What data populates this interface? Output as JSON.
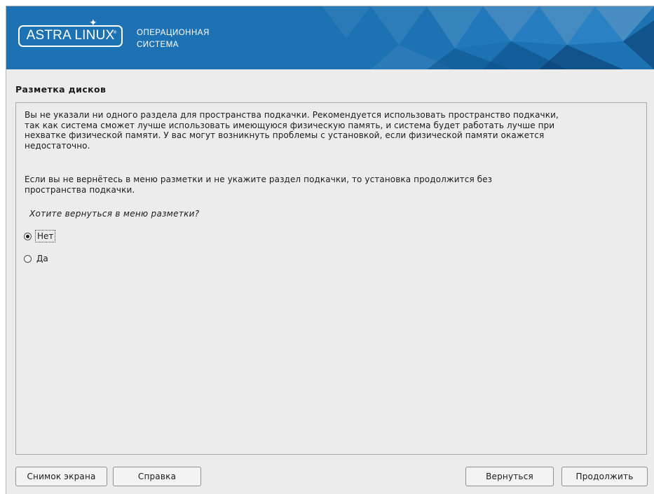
{
  "header": {
    "logo_text": "ASTRA LINUX",
    "subtitle_line1": "ОПЕРАЦИОННАЯ",
    "subtitle_line2": "СИСТЕМА",
    "banner_color": "#1c72b3"
  },
  "page": {
    "title": "Разметка дисков"
  },
  "message": {
    "paragraph1_lines": [
      "Вы не указали ни одного раздела для пространства подкачки. Рекомендуется использовать пространство подкачки,",
      "так как система сможет лучше использовать имеющуюся физическую память, и система будет работать лучше при",
      "нехватке физической памяти. У вас могут возникнуть проблемы с установкой, если физической памяти окажется",
      "недостаточно."
    ],
    "paragraph2_lines": [
      "Если вы не вернётесь в меню разметки и не укажите раздел подкачки, то установка продолжится без",
      "пространства подкачки."
    ],
    "question": "Хотите вернуться в меню разметки?"
  },
  "options": [
    {
      "label": "Нет",
      "selected": true
    },
    {
      "label": "Да",
      "selected": false
    }
  ],
  "buttons": {
    "screenshot": "Снимок экрана",
    "help": "Справка",
    "back": "Вернуться",
    "continue": "Продолжить"
  }
}
